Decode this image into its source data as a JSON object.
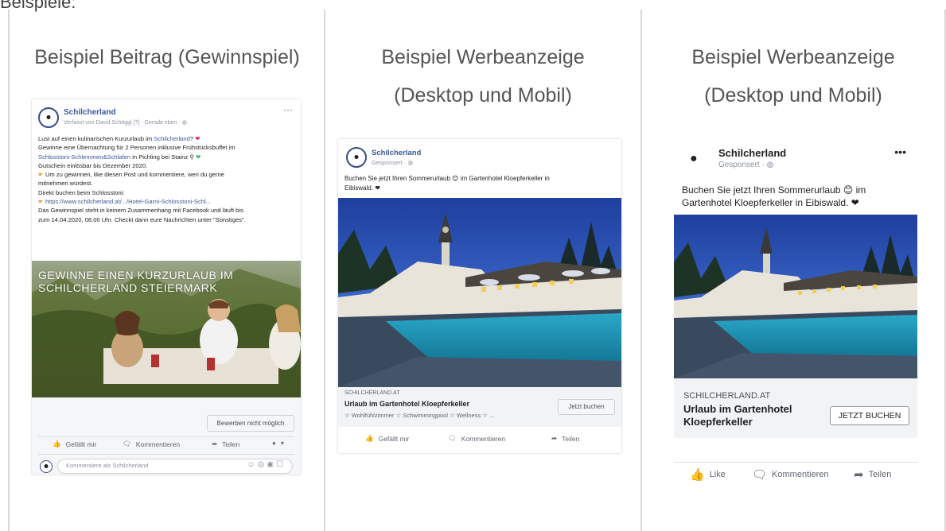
{
  "top_label": "Beispiele:",
  "columns": [
    {
      "title_line1": "Beispiel Beitrag (Gewinnspiel)"
    },
    {
      "title_line1": "Beispiel Werbeanzeige",
      "title_line2": "(Desktop und Mobil)"
    },
    {
      "title_line1": "Beispiel Werbeanzeige",
      "title_line2": "(Desktop und Mobil)"
    }
  ],
  "post": {
    "page_name": "Schilcherland",
    "meta": "Verfasst von David Schöggl [?] · Gerade eben · ",
    "more": "···",
    "line1a": "Lust auf einen kulinarischen Kurzurlaub im ",
    "line1link": "Schilcherland",
    "line1b": "? ",
    "line2": "Gewinne eine Übernachtung für 2 Personen inklusive Frühstücksbuffet im",
    "line3link": "Schlosstoni-Schlemmen&Schlafen",
    "line3b": " in Pichling bei Stainz",
    "line4": "Gutschein einlösbar bis Dezember 2020.",
    "line5": "Um zu gewinnen, like diesen Post und kommentiere, wen du gerne",
    "line6": "mitnehmen würdest.",
    "line7": "Direkt buchen beim Schlosstoni:",
    "line8link": "https://www.schilcherland.at/.../Hotel-Garni-Schlosstoni-Schl...",
    "line9": "Das Gewinnspiel steht in keinem Zusammenhang mit Facebook und läuft bis",
    "line10": "zum 14.04.2020, 08.00 Uhr. Checkt dann eure Nachrichten unter \"Sonstiges\".",
    "photo_overlay_1": "GEWINNE EINEN KURZURLAUB IM",
    "photo_overlay_2": "SCHILCHERLAND STEIERMARK",
    "apply_button": "Bewerben nicht möglich",
    "like": "Gefällt mir",
    "comment": "Kommentieren",
    "share": "Teilen",
    "comment_placeholder": "Kommentiere als Schilcherland"
  },
  "ad_desktop": {
    "page_name": "Schilcherland",
    "meta": "Gesponsert · ",
    "text1": "Buchen Sie jetzt Ihren Sommerurlaub 😊 im Gartenhotel Kloepferkeller in",
    "text2": "Eibiswald. ❤",
    "domain": "SCHILCHERLAND.AT",
    "headline": "Urlaub im Gartenhotel Kloepferkeller",
    "desc": "☆ Wohlfühlzimmer ☆ Schwimmingpool ☆ Wellness ☆ ...",
    "cta": "Jetzt buchen",
    "like": "Gefällt mir",
    "comment": "Kommentieren",
    "share": "Teilen"
  },
  "ad_mobile": {
    "page_name": "Schilcherland",
    "meta": "Gesponsert · ",
    "more": "•••",
    "text1": "Buchen Sie jetzt Ihren Sommerurlaub 😊 im",
    "text2": "Gartenhotel Kloepferkeller in Eibiswald. ❤",
    "domain": "SCHILCHERLAND.AT",
    "headline1": "Urlaub im Gartenhotel",
    "headline2": "Kloepferkeller",
    "cta": "JETZT BUCHEN",
    "like": "Like",
    "comment": "Kommentieren",
    "share": "Teilen"
  }
}
